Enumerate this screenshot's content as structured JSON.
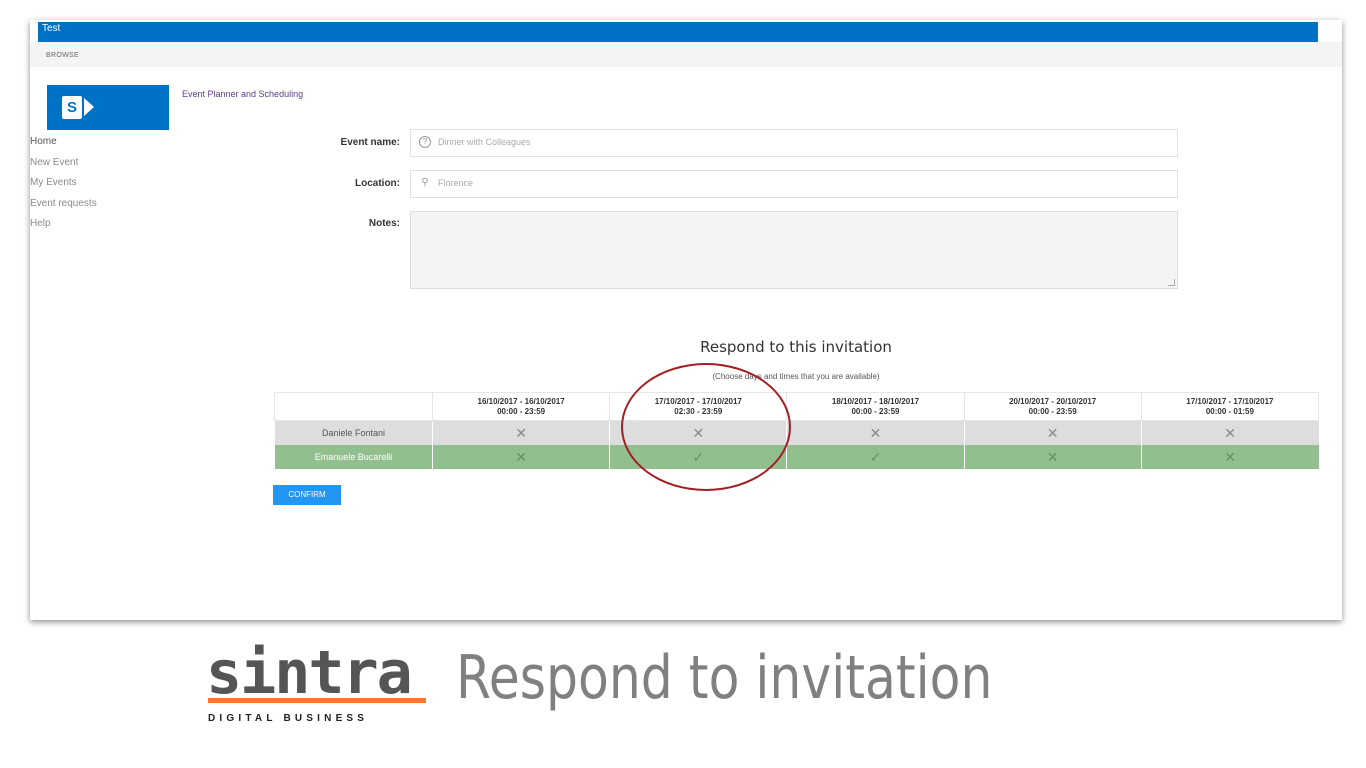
{
  "suitebar": {
    "title": "Test"
  },
  "ribbon": {
    "tab": "BROWSE"
  },
  "logo": {
    "letter": "S"
  },
  "site_title": "Event Planner and Scheduling",
  "nav": [
    "Home",
    "New Event",
    "My Events",
    "Event requests",
    "Help"
  ],
  "form": {
    "event_name_label": "Event name:",
    "event_name_value": "Dinner with Colleagues",
    "location_label": "Location:",
    "location_value": "Florence",
    "notes_label": "Notes:"
  },
  "respond": {
    "title": "Respond to this invitation",
    "subtitle": "(Choose days and times that you are available)"
  },
  "schedule": {
    "columns": [
      {
        "dates": "16/10/2017 - 16/10/2017",
        "times": "00:00 - 23:59"
      },
      {
        "dates": "17/10/2017 - 17/10/2017",
        "times": "02:30 - 23:59"
      },
      {
        "dates": "18/10/2017 - 18/10/2017",
        "times": "00:00 - 23:59"
      },
      {
        "dates": "20/10/2017 - 20/10/2017",
        "times": "00:00 - 23:59"
      },
      {
        "dates": "17/10/2017 - 17/10/2017",
        "times": "00:00 - 01:59"
      }
    ],
    "rows": [
      {
        "name": "Daniele Fontani",
        "marks": [
          "✕",
          "✕",
          "✕",
          "✕",
          "✕"
        ]
      },
      {
        "name": "Emanuele Bucarelli",
        "marks": [
          "✕",
          "✓",
          "✓",
          "✕",
          "✕"
        ]
      }
    ]
  },
  "confirm_label": "CONFIRM",
  "brand": {
    "name": "sintra",
    "tagline": "DIGITAL BUSINESS",
    "caption": "Respond to invitation"
  }
}
